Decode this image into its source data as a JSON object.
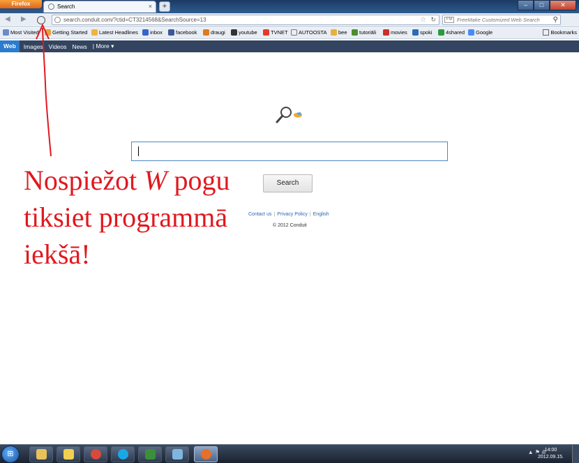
{
  "window": {
    "firefox_menu": "Firefox",
    "tab_title": "Search",
    "new_tab": "+",
    "tab_close": "×",
    "controls": {
      "minimize": "–",
      "maximize": "□",
      "close": "✕"
    }
  },
  "navbar": {
    "back": "◀",
    "forward": "▶",
    "url": "search.conduit.com/?ctid=CT3214568&SearchSource=13",
    "star": "☆",
    "reload": "↻",
    "search_placeholder": "FreeMake Customized Web Search",
    "search_engine": "FM",
    "search_go": "⚲"
  },
  "bookmarks": [
    {
      "label": "Most Visited",
      "icon": "#6b8cc8"
    },
    {
      "label": "Getting Started",
      "icon": "#e8a23c"
    },
    {
      "label": "Latest Headlines",
      "icon": "#f2b23d"
    },
    {
      "label": "inbox",
      "icon": "#3566c9"
    },
    {
      "label": "facebook",
      "icon": "#3b5998"
    },
    {
      "label": "draugi",
      "icon": "#e07a1f"
    },
    {
      "label": "youtube",
      "icon": "#333333"
    },
    {
      "label": "TVNET",
      "icon": "#e33a2b"
    },
    {
      "label": "AUTOOSTA",
      "icon": "#ffffff"
    },
    {
      "label": "bee",
      "icon": "#e8b13c"
    },
    {
      "label": "tutoriāli",
      "icon": "#4b8f2d"
    },
    {
      "label": "movies",
      "icon": "#c9302a"
    },
    {
      "label": "spoki",
      "icon": "#2c6cb2"
    },
    {
      "label": "4shared",
      "icon": "#2b9a3d"
    },
    {
      "label": "Google",
      "icon": "#4a8af4"
    }
  ],
  "bookmarks_menu": "Bookmarks",
  "conduit_nav": {
    "web": "Web",
    "images": "Images",
    "videos": "Videos",
    "news": "News",
    "more": "| More ▾"
  },
  "search": {
    "button": "Search",
    "links": [
      "Contact us",
      "Privacy Policy",
      "English"
    ],
    "separator": "|",
    "copyright": "© 2012 Conduit"
  },
  "annotation": {
    "line1_prefix": "Nospiežot ",
    "line1_letter": "W",
    "line1_suffix": " pogu",
    "line2": "tiksiet programmā",
    "line3": "iekšā!"
  },
  "taskbar": {
    "start": "⊞",
    "apps": [
      {
        "name": "explorer",
        "color": "#e8c15a"
      },
      {
        "name": "media",
        "color": "#f0d050"
      },
      {
        "name": "chrome",
        "color": "#d84a3a"
      },
      {
        "name": "skype",
        "color": "#19a8e6"
      },
      {
        "name": "terminal",
        "color": "#3b8f3b"
      },
      {
        "name": "notes",
        "color": "#7fb6e0"
      },
      {
        "name": "firefox",
        "color": "#e5702a"
      }
    ],
    "time": "14:00",
    "date": "2012.09.15.",
    "tray": "▲ ⚑ ıll"
  }
}
